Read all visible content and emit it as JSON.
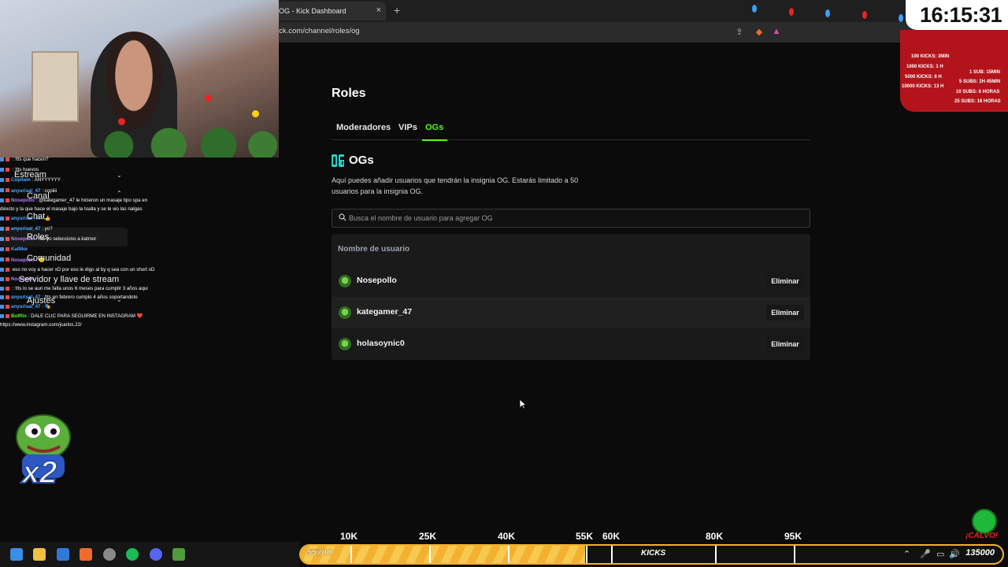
{
  "browser": {
    "tab_title": "OG - Kick Dashboard",
    "tab_close": "×",
    "new_tab": "+",
    "url": "ick.com/channel/roles/og"
  },
  "chat": [
    {
      "user": "",
      "user_color": "#4fa8ff",
      "msg": ": !tts que hacen?"
    },
    {
      "user": "",
      "user_color": "#4fa8ff",
      "msg": ": !tts huevos"
    },
    {
      "user": "Copitam",
      "user_color": "#4fa8ff",
      "msg": ": ANYYYYYY"
    },
    {
      "user": "anyurisal_47",
      "user_color": "#4fa8ff",
      "msg": ": copiiii"
    },
    {
      "user": "Nosepollo",
      "user_color": "#b57bff",
      "msg": ": @kategamer_47 le hicieron un masaje tipo spa en directo y la que hace el masaje bajo la toalla y se le vio las nalgas",
      "wrap": true
    },
    {
      "user": "anyurisal_47",
      "user_color": "#4fa8ff",
      "msg": ": 👍"
    },
    {
      "user": "anyurisal_47",
      "user_color": "#4fa8ff",
      "msg": ": yo?"
    },
    {
      "user": "Nosepollo",
      "user_color": "#b57bff",
      "msg": ": !tts yo selecciono a katmor"
    },
    {
      "user": "KatMor",
      "user_color": "#4fa8ff",
      "msg": ""
    },
    {
      "user": "Nosepollo",
      "user_color": "#b57bff",
      "msg": ": 😊"
    },
    {
      "user": "",
      "user_color": "#4fa8ff",
      "msg": "eso no voy a hacer xD por eso le digo al by q sea con un short xD",
      "wrap": true
    },
    {
      "user": "Nosepollo",
      "user_color": "#b57bff",
      "msg": ""
    },
    {
      "user": "",
      "user_color": "#4fa8ff",
      "msg": ": !tts lo se aun me falta unos 6 meses para cumplir 3 años aqui",
      "wrap": true
    },
    {
      "user": "anyurisal_47",
      "user_color": "#4fa8ff",
      "msg": ": !tts en febrero cumplo 4 años soportandote",
      "wrap": true
    },
    {
      "user": "anyurisal_47",
      "user_color": "#4fa8ff",
      "msg": ": 🎭"
    },
    {
      "user": "BotRix",
      "user_color": "#53fc18",
      "msg": ": DALE CLIC PARA SEGUIRME EN INSTAGRAM ❤️ https://www.instagram.com/jcarlos.22/",
      "wrap": true
    }
  ],
  "sidebar": {
    "items": [
      {
        "label": "Estream"
      },
      {
        "label": "Canal"
      },
      {
        "label": "Chat"
      },
      {
        "label": "Roles"
      },
      {
        "label": "Comunidad"
      },
      {
        "label": "Servidor y llave de stream"
      },
      {
        "label": "Ajustes"
      }
    ]
  },
  "main": {
    "title": "Roles",
    "tabs": [
      {
        "label": "Moderadores"
      },
      {
        "label": "VIPs"
      },
      {
        "label": "OGs"
      }
    ],
    "og_heading": "OGs",
    "og_description": "Aquí puedes añadir usuarios que tendrán la insignia OG. Estarás limitado a 50 usuarios para la insignia OG.",
    "search_placeholder": "Busca el nombre de usuario para agregar OG",
    "column_header": "Nombre de usuario",
    "users": [
      {
        "name": "Nosepollo",
        "action": "Eliminar"
      },
      {
        "name": "kategamer_47",
        "action": "Eliminar"
      },
      {
        "name": "holasoynic0",
        "action": "Eliminar"
      }
    ]
  },
  "overlay": {
    "clock": "16:15:31",
    "goals_left": [
      "100 KICKS: 3MIN",
      "1000 KICKS: 1 H",
      "5000 KICKS: 6 H",
      "10000 KICKS: 13 H"
    ],
    "goals_right": [
      "1 SUB: 15MIN",
      "5 SUBS: 2H 45MIN",
      "10 SUBS: 6 HORAS",
      "25 SUBS: 16 HORAS"
    ],
    "x2": "x2",
    "calvo": "¡CALVO!"
  },
  "kicks_bar": {
    "current": 55700,
    "current_label": "55700",
    "target_label": "135000",
    "name": "KICKS",
    "milestones": [
      "10K",
      "25K",
      "40K",
      "55K",
      "60K",
      "80K",
      "95K"
    ],
    "fill_fraction": 0.405
  }
}
